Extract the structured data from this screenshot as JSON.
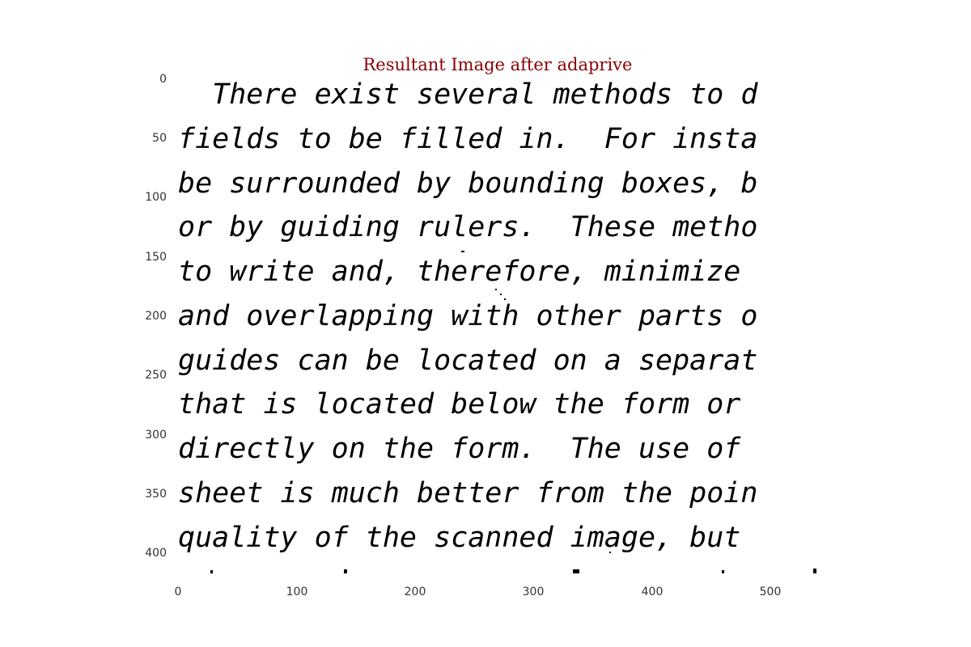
{
  "title": "Resultant Image after adaprive",
  "lines": [
    "  There exist several methods to d",
    "fields to be filled in.  For insta",
    "be surrounded by bounding boxes, b",
    "or by guiding rulers.  These metho",
    "to write and, therefore, minimize ",
    "and overlapping with other parts o",
    "guides can be located on a separat",
    "that is located below the form or ",
    "directly on the form.  The use of ",
    "sheet is much better from the poin",
    "quality of the scanned image, but "
  ],
  "y_ticks": [
    "0",
    "50",
    "100",
    "150",
    "200",
    "250",
    "300",
    "350",
    "400"
  ],
  "x_ticks": [
    "0",
    "100",
    "200",
    "300",
    "400",
    "500"
  ]
}
